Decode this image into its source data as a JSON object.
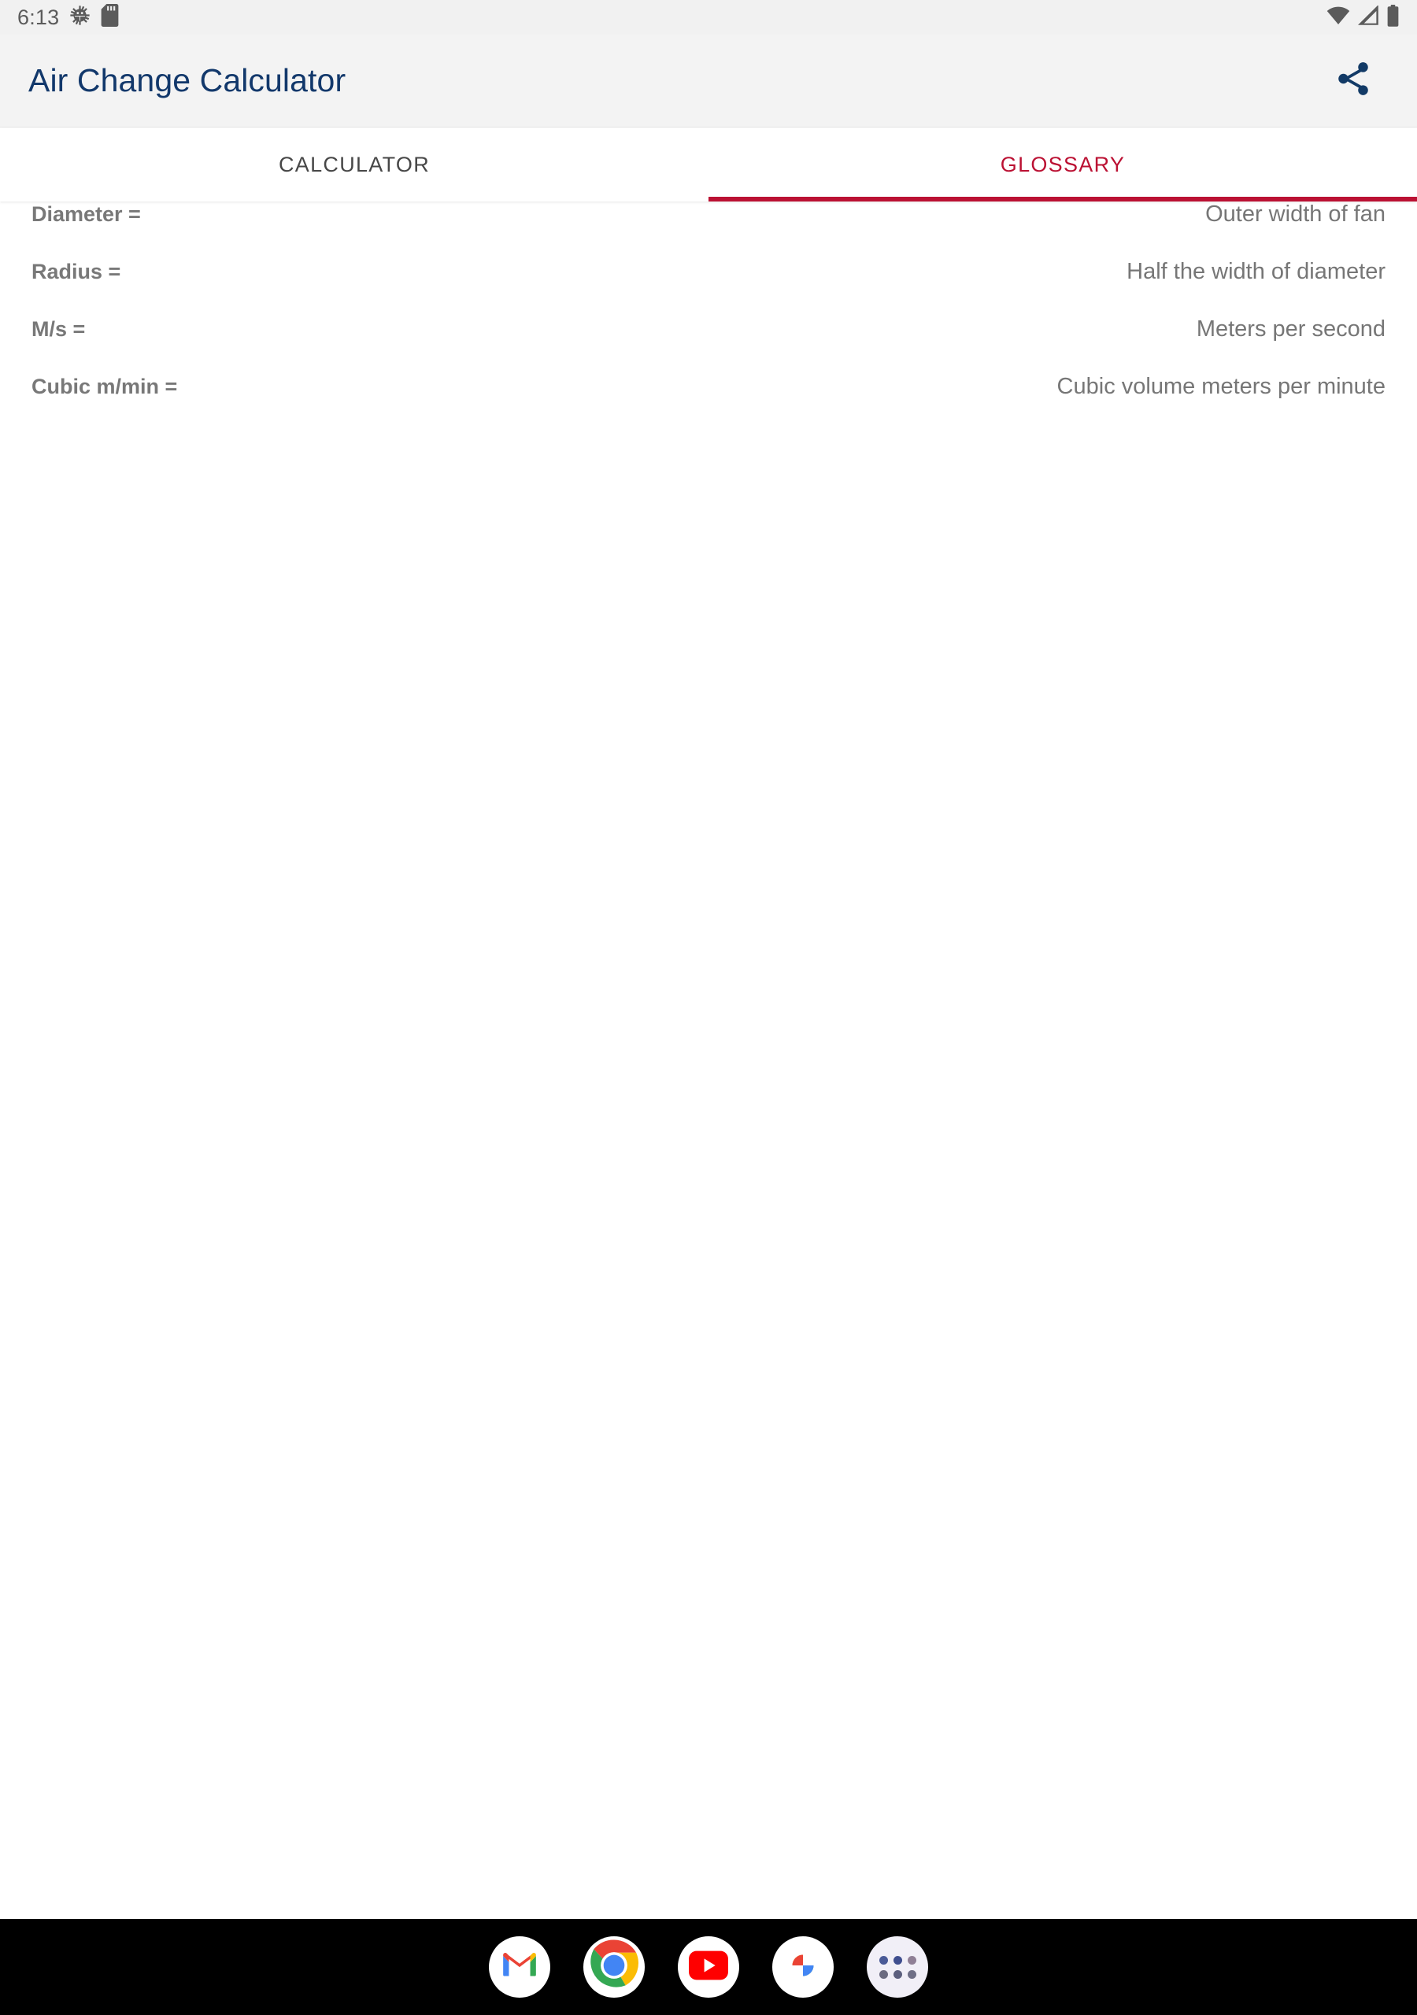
{
  "status_bar": {
    "time": "6:13",
    "left_icons": [
      "bug-gear-icon",
      "sd-card-icon"
    ],
    "right_icons": [
      "wifi-icon",
      "cellular-signal-icon",
      "battery-icon"
    ],
    "background": "#f1f1f1"
  },
  "app_bar": {
    "title": "Air Change Calculator",
    "title_color": "#12386b",
    "share_icon": "share-icon",
    "background": "#f3f3f3"
  },
  "tabs": [
    {
      "label": "CALCULATOR",
      "active": false
    },
    {
      "label": "GLOSSARY",
      "active": true
    }
  ],
  "tab_accent_color": "#bb1133",
  "glossary": {
    "rows": [
      {
        "term": "Diameter =",
        "definition": "Outer width of fan"
      },
      {
        "term": "Radius =",
        "definition": "Half the width of diameter"
      },
      {
        "term": "M/s =",
        "definition": "Meters per second"
      },
      {
        "term": "Cubic m/min =",
        "definition": "Cubic volume meters per minute"
      }
    ]
  },
  "dock": {
    "background": "#000000",
    "items": [
      {
        "name": "gmail-icon",
        "label": "Gmail"
      },
      {
        "name": "chrome-icon",
        "label": "Chrome"
      },
      {
        "name": "youtube-icon",
        "label": "YouTube"
      },
      {
        "name": "google-photos-icon",
        "label": "Photos"
      },
      {
        "name": "app-drawer-icon",
        "label": "All apps"
      }
    ]
  }
}
